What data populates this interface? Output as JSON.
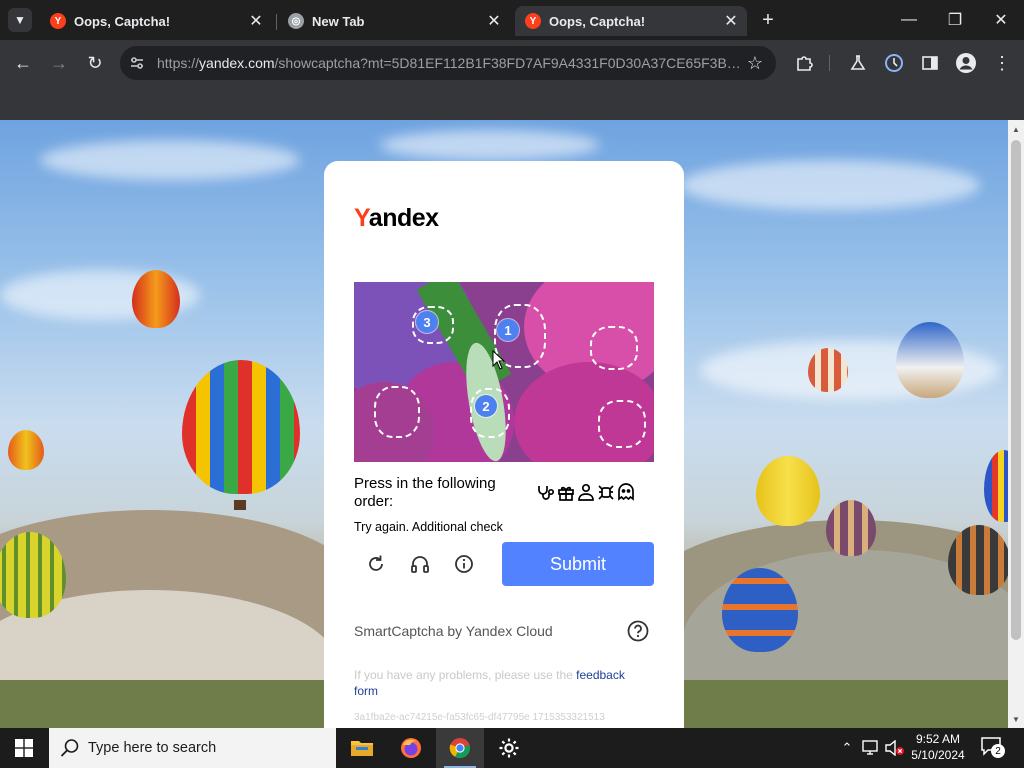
{
  "browser": {
    "tabs": [
      {
        "title": "Oops, Captcha!",
        "favicon": "yandex-icon",
        "active": false
      },
      {
        "title": "New Tab",
        "favicon": "globe-icon",
        "active": false
      },
      {
        "title": "Oops, Captcha!",
        "favicon": "yandex-icon",
        "active": true
      }
    ],
    "url_scheme": "https://",
    "url_domain": "yandex.com",
    "url_rest": "/showcaptcha?mt=5D81EF112B1F38FD7AF9A4331F0D30A37CE65F3BC8B..."
  },
  "captcha": {
    "logo_first": "Y",
    "logo_rest": "andex",
    "markers": [
      "1",
      "2",
      "3"
    ],
    "instruction": "Press in the following order:",
    "order_icons": [
      "stethoscope-icon",
      "gift-icon",
      "person-icon",
      "bug-icon",
      "ghost-icon"
    ],
    "status": "Try again. Additional check",
    "submit_label": "Submit",
    "provider": "SmartCaptcha by Yandex Cloud",
    "problems_text": "If you have any problems, please use the ",
    "problems_link": "feedback form",
    "hash": "3a1fba2e-ac74215e-fa53fc65-df47795e 1715353321513",
    "accent": "#5282ff"
  },
  "taskbar": {
    "search_placeholder": "Type here to search",
    "time": "9:52 AM",
    "date": "5/10/2024",
    "notification_count": "2"
  }
}
